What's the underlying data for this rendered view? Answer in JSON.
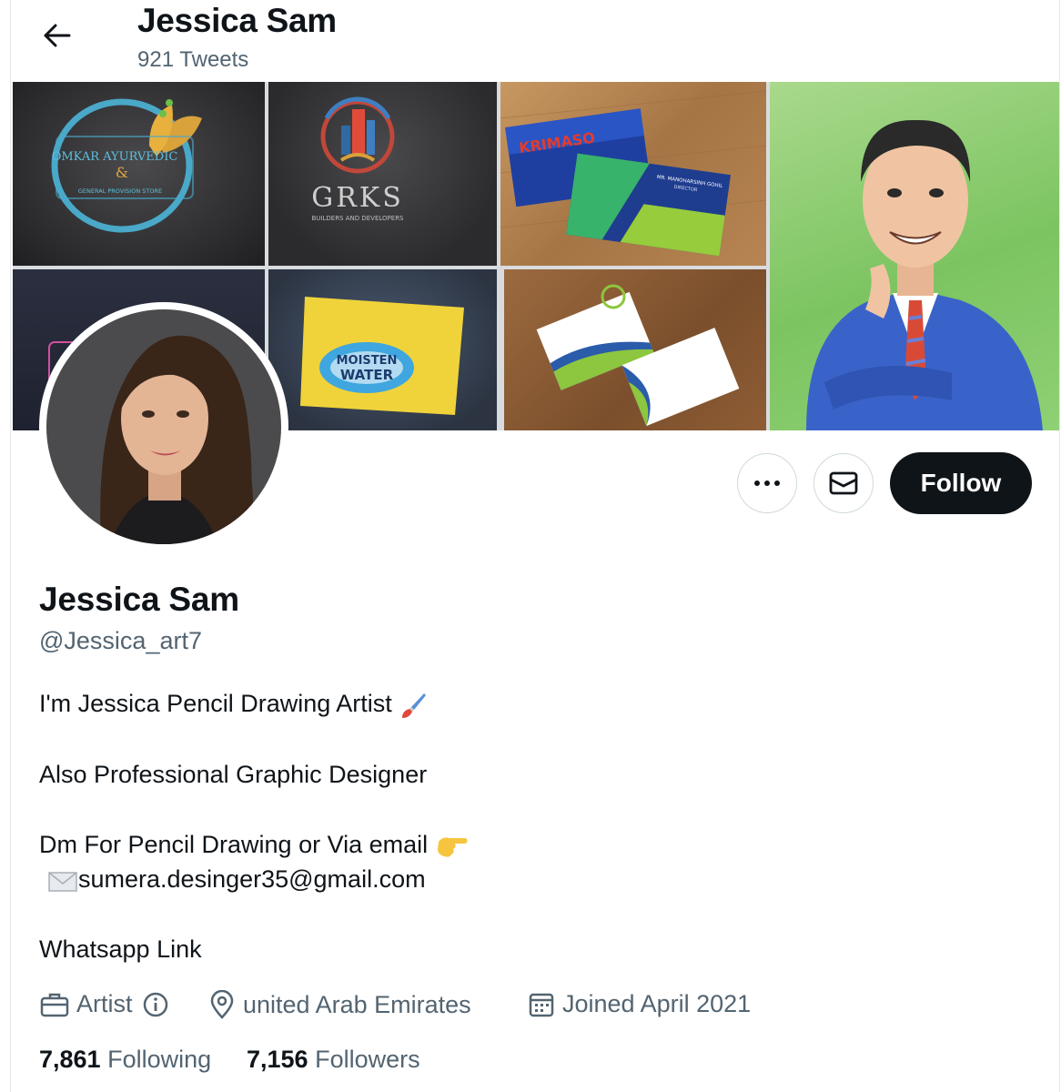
{
  "header": {
    "title": "Jessica Sam",
    "tweet_count": "921 Tweets"
  },
  "banner": {
    "tile1_text_line1": "OMKAR AYURVEDIC",
    "tile1_text_line2": "&",
    "tile1_text_line3": "GENERAL PROVISION STORE",
    "tile2_text_line1": "GRKS",
    "tile2_text_line2": "BUILDERS AND DEVELOPERS",
    "tile3_text_brand": "KRIMASO",
    "tile3_text_person": "MR. MANOHARSINH GOHIL",
    "tile3_text_role": "DIRECTOR",
    "tile6_text_line1": "MOISTEN",
    "tile6_text_line2": "WATER"
  },
  "actions": {
    "more_icon": "more-dots-icon",
    "message_icon": "envelope-icon",
    "follow_label": "Follow"
  },
  "profile": {
    "name": "Jessica Sam",
    "handle": "@Jessica_art7",
    "bio_line1": "I'm Jessica Pencil Drawing Artist",
    "bio_line2": "Also Professional Graphic Designer",
    "bio_line3": "Dm For Pencil Drawing or Via email",
    "bio_line4": "sumera.desinger35@gmail.com",
    "bio_line5": "Whatsapp Link",
    "category": "Artist",
    "location": "united Arab Emirates",
    "joined": "Joined April 2021",
    "following_count": "7,861",
    "following_label": "Following",
    "followers_count": "7,156",
    "followers_label": "Followers"
  },
  "colors": {
    "text_primary": "#0f1419",
    "text_secondary": "#536471",
    "border": "#cfd9de",
    "follow_bg": "#0f1419"
  }
}
